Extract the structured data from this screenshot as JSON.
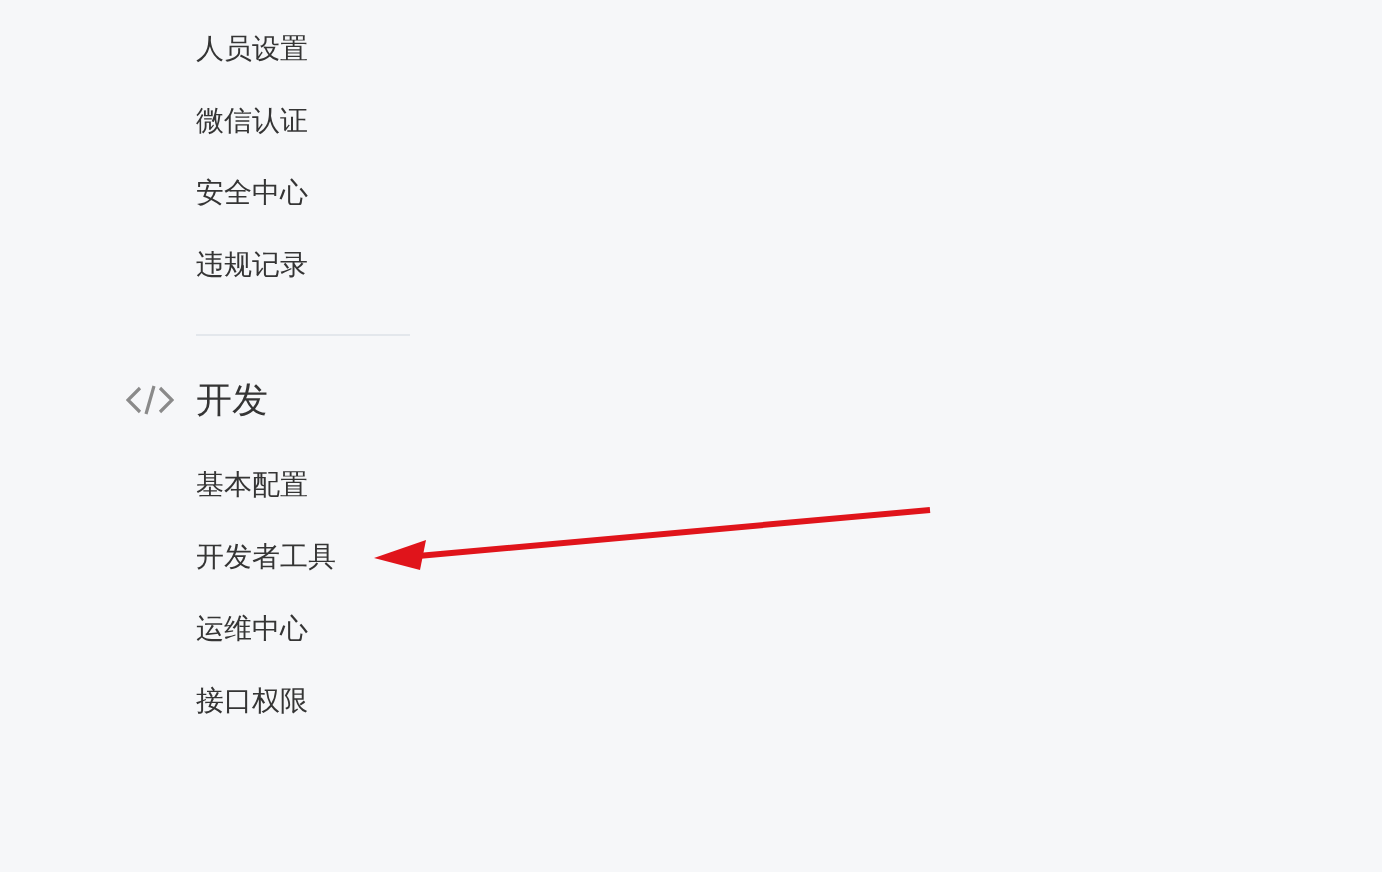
{
  "sections": [
    {
      "items": [
        "人员设置",
        "微信认证",
        "安全中心",
        "违规记录"
      ]
    },
    {
      "title": "开发",
      "items": [
        "基本配置",
        "开发者工具",
        "运维中心",
        "接口权限"
      ]
    }
  ]
}
